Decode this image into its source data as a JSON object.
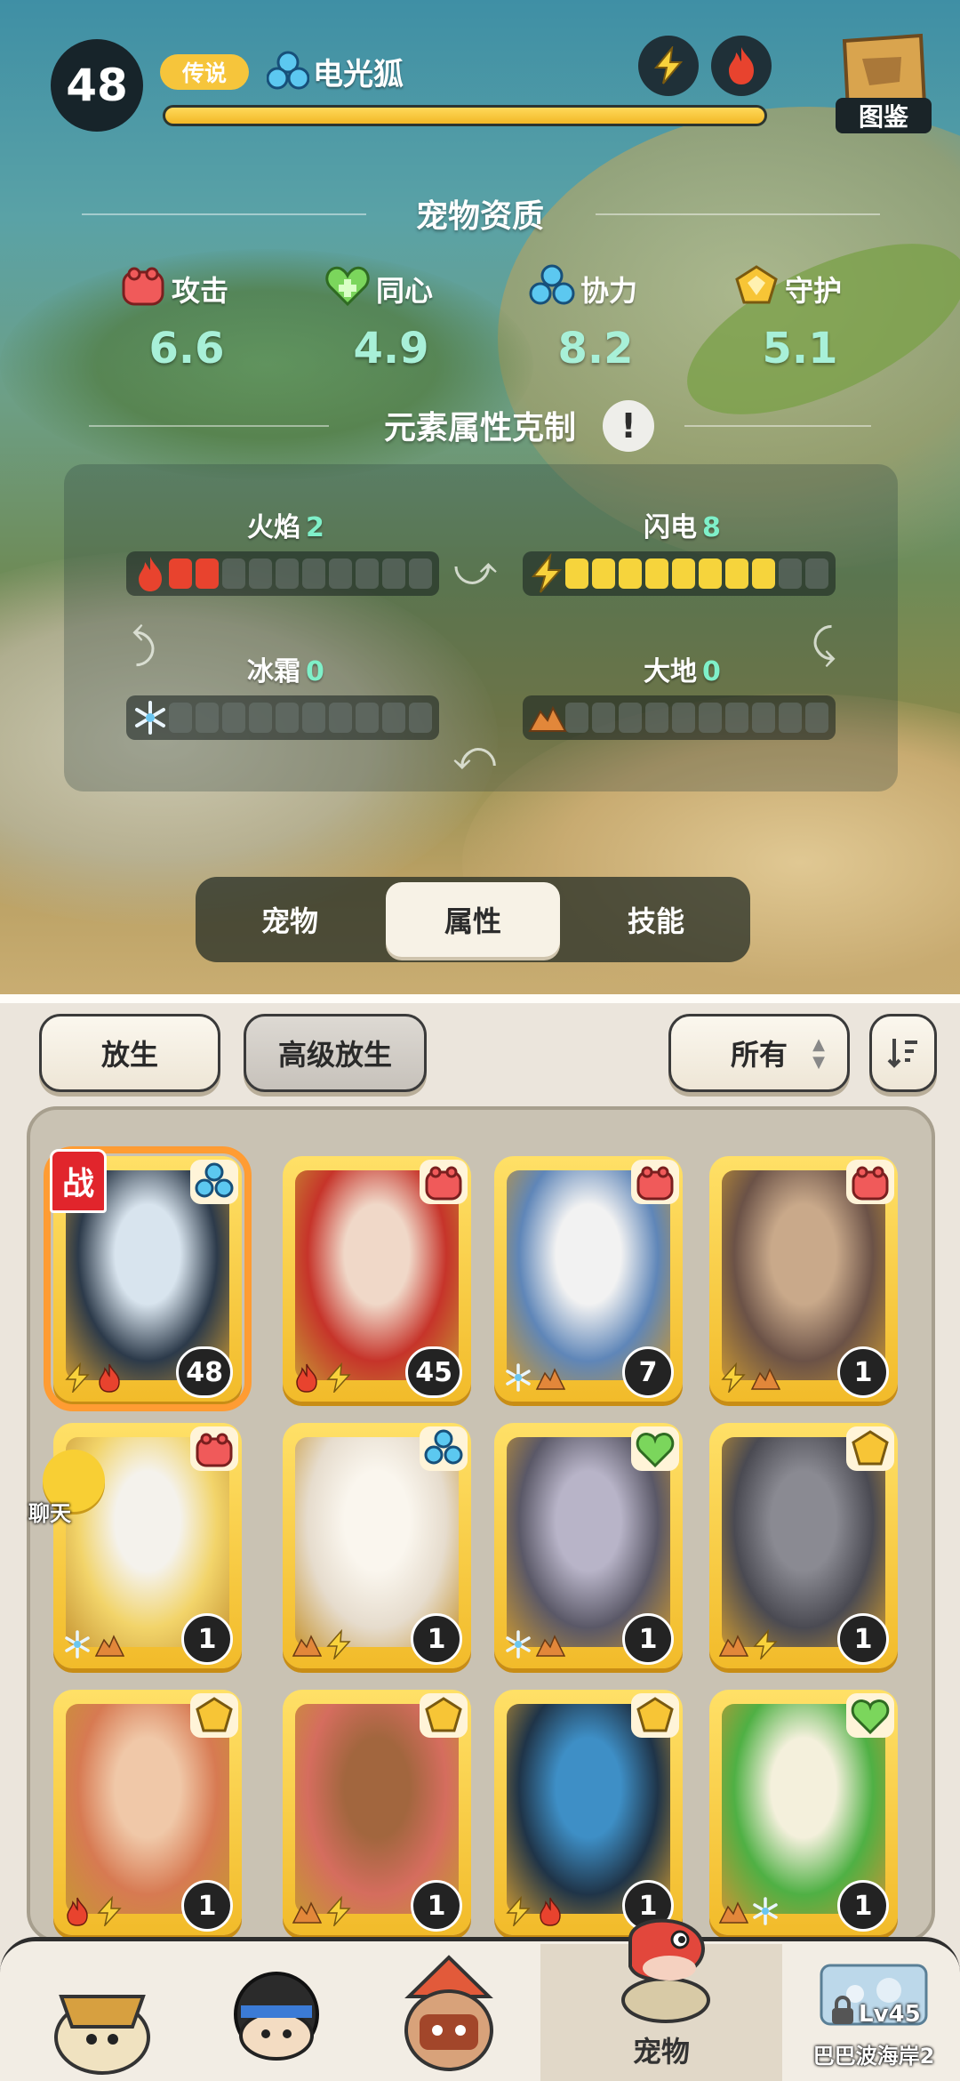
{
  "header": {
    "level": "48",
    "rarity": "传说",
    "pet_name": "电光狐",
    "exp_percent": 1.0,
    "book_label": "图鉴"
  },
  "qualities": {
    "title": "宠物资质",
    "items": [
      {
        "label": "攻击",
        "value": "6.6",
        "icon": "red-claw-icon"
      },
      {
        "label": "同心",
        "value": "4.9",
        "icon": "green-heart-icon"
      },
      {
        "label": "协力",
        "value": "8.2",
        "icon": "blue-team-icon"
      },
      {
        "label": "守护",
        "value": "5.1",
        "icon": "gold-shield-icon"
      }
    ]
  },
  "elements": {
    "title": "元素属性克制",
    "info_icon": "!",
    "items": [
      {
        "name": "火焰",
        "value": "2",
        "filled": 2,
        "total": 10,
        "icon": "flame-icon",
        "color": "#e8432e"
      },
      {
        "name": "闪电",
        "value": "8",
        "filled": 8,
        "total": 10,
        "icon": "lightning-icon",
        "color": "#f6d43c"
      },
      {
        "name": "冰霜",
        "value": "0",
        "filled": 0,
        "total": 10,
        "icon": "snowflake-icon",
        "color": "#ffffff"
      },
      {
        "name": "大地",
        "value": "0",
        "filled": 0,
        "total": 10,
        "icon": "earth-icon",
        "color": "#e2873a"
      }
    ]
  },
  "tabs": [
    {
      "label": "宠物",
      "active": false
    },
    {
      "label": "属性",
      "active": true
    },
    {
      "label": "技能",
      "active": false
    }
  ],
  "actions": {
    "release": "放生",
    "advanced_release": "高级放生",
    "filter": "所有"
  },
  "pets": [
    {
      "level": "48",
      "trait": "blue",
      "elements": [
        "lightning",
        "fire"
      ],
      "battle": "战",
      "colors": [
        "#2c3a4a",
        "#d8e4ee"
      ]
    },
    {
      "level": "45",
      "trait": "red",
      "elements": [
        "fire",
        "lightning"
      ],
      "colors": [
        "#c6342a",
        "#f0d8c8"
      ]
    },
    {
      "level": "7",
      "trait": "red",
      "elements": [
        "ice",
        "earth"
      ],
      "colors": [
        "#5f86b8",
        "#f2f2f2"
      ]
    },
    {
      "level": "1",
      "trait": "red",
      "elements": [
        "lightning",
        "earth"
      ],
      "colors": [
        "#6b5247",
        "#c9a98a"
      ]
    },
    {
      "level": "1",
      "trait": "red",
      "elements": [
        "ice",
        "earth"
      ],
      "colors": [
        "#f2d46a",
        "#f4f2ec"
      ]
    },
    {
      "level": "1",
      "trait": "blue",
      "elements": [
        "earth",
        "lightning"
      ],
      "colors": [
        "#e6dccd",
        "#faf6ee"
      ]
    },
    {
      "level": "1",
      "trait": "green",
      "elements": [
        "ice",
        "earth"
      ],
      "colors": [
        "#5a5867",
        "#b8b4c8"
      ]
    },
    {
      "level": "1",
      "trait": "gold",
      "elements": [
        "earth",
        "lightning"
      ],
      "colors": [
        "#4a4a52",
        "#8a8a92"
      ]
    },
    {
      "level": "1",
      "trait": "gold",
      "elements": [
        "fire",
        "lightning"
      ],
      "colors": [
        "#d77a52",
        "#f0c8a8"
      ]
    },
    {
      "level": "1",
      "trait": "gold",
      "elements": [
        "earth",
        "lightning"
      ],
      "colors": [
        "#d56d5e",
        "#a2663e"
      ]
    },
    {
      "level": "1",
      "trait": "gold",
      "elements": [
        "lightning",
        "fire"
      ],
      "colors": [
        "#1f3448",
        "#3e8fc6"
      ]
    },
    {
      "level": "1",
      "trait": "green",
      "elements": [
        "earth",
        "ice"
      ],
      "colors": [
        "#4fb044",
        "#f4f0dc"
      ]
    }
  ],
  "chat": {
    "label": "聊天"
  },
  "nav": {
    "active_label": "宠物",
    "locked_level": "Lv45",
    "locked_place": "巴巴波海岸2"
  }
}
